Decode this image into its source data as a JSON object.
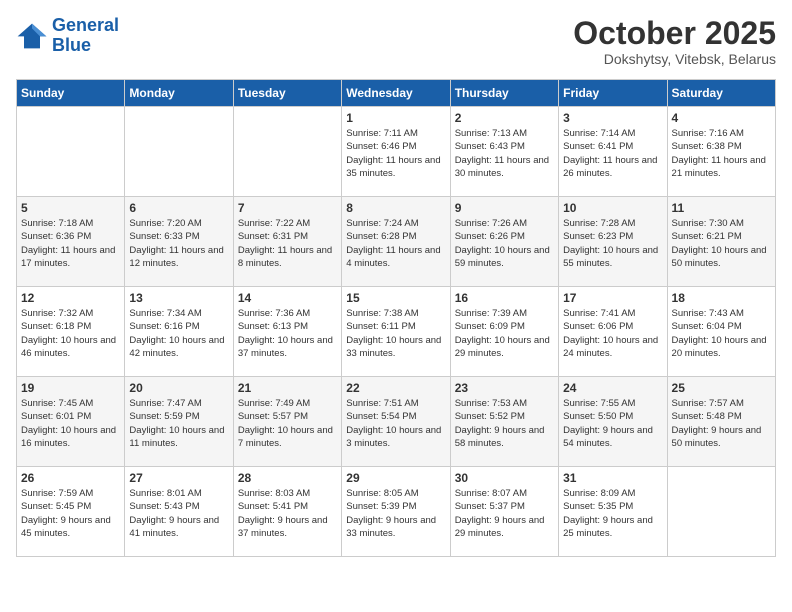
{
  "header": {
    "logo_line1": "General",
    "logo_line2": "Blue",
    "month": "October 2025",
    "location": "Dokshytsy, Vitebsk, Belarus"
  },
  "days_of_week": [
    "Sunday",
    "Monday",
    "Tuesday",
    "Wednesday",
    "Thursday",
    "Friday",
    "Saturday"
  ],
  "weeks": [
    [
      {
        "day": "",
        "info": ""
      },
      {
        "day": "",
        "info": ""
      },
      {
        "day": "",
        "info": ""
      },
      {
        "day": "1",
        "info": "Sunrise: 7:11 AM\nSunset: 6:46 PM\nDaylight: 11 hours and 35 minutes."
      },
      {
        "day": "2",
        "info": "Sunrise: 7:13 AM\nSunset: 6:43 PM\nDaylight: 11 hours and 30 minutes."
      },
      {
        "day": "3",
        "info": "Sunrise: 7:14 AM\nSunset: 6:41 PM\nDaylight: 11 hours and 26 minutes."
      },
      {
        "day": "4",
        "info": "Sunrise: 7:16 AM\nSunset: 6:38 PM\nDaylight: 11 hours and 21 minutes."
      }
    ],
    [
      {
        "day": "5",
        "info": "Sunrise: 7:18 AM\nSunset: 6:36 PM\nDaylight: 11 hours and 17 minutes."
      },
      {
        "day": "6",
        "info": "Sunrise: 7:20 AM\nSunset: 6:33 PM\nDaylight: 11 hours and 12 minutes."
      },
      {
        "day": "7",
        "info": "Sunrise: 7:22 AM\nSunset: 6:31 PM\nDaylight: 11 hours and 8 minutes."
      },
      {
        "day": "8",
        "info": "Sunrise: 7:24 AM\nSunset: 6:28 PM\nDaylight: 11 hours and 4 minutes."
      },
      {
        "day": "9",
        "info": "Sunrise: 7:26 AM\nSunset: 6:26 PM\nDaylight: 10 hours and 59 minutes."
      },
      {
        "day": "10",
        "info": "Sunrise: 7:28 AM\nSunset: 6:23 PM\nDaylight: 10 hours and 55 minutes."
      },
      {
        "day": "11",
        "info": "Sunrise: 7:30 AM\nSunset: 6:21 PM\nDaylight: 10 hours and 50 minutes."
      }
    ],
    [
      {
        "day": "12",
        "info": "Sunrise: 7:32 AM\nSunset: 6:18 PM\nDaylight: 10 hours and 46 minutes."
      },
      {
        "day": "13",
        "info": "Sunrise: 7:34 AM\nSunset: 6:16 PM\nDaylight: 10 hours and 42 minutes."
      },
      {
        "day": "14",
        "info": "Sunrise: 7:36 AM\nSunset: 6:13 PM\nDaylight: 10 hours and 37 minutes."
      },
      {
        "day": "15",
        "info": "Sunrise: 7:38 AM\nSunset: 6:11 PM\nDaylight: 10 hours and 33 minutes."
      },
      {
        "day": "16",
        "info": "Sunrise: 7:39 AM\nSunset: 6:09 PM\nDaylight: 10 hours and 29 minutes."
      },
      {
        "day": "17",
        "info": "Sunrise: 7:41 AM\nSunset: 6:06 PM\nDaylight: 10 hours and 24 minutes."
      },
      {
        "day": "18",
        "info": "Sunrise: 7:43 AM\nSunset: 6:04 PM\nDaylight: 10 hours and 20 minutes."
      }
    ],
    [
      {
        "day": "19",
        "info": "Sunrise: 7:45 AM\nSunset: 6:01 PM\nDaylight: 10 hours and 16 minutes."
      },
      {
        "day": "20",
        "info": "Sunrise: 7:47 AM\nSunset: 5:59 PM\nDaylight: 10 hours and 11 minutes."
      },
      {
        "day": "21",
        "info": "Sunrise: 7:49 AM\nSunset: 5:57 PM\nDaylight: 10 hours and 7 minutes."
      },
      {
        "day": "22",
        "info": "Sunrise: 7:51 AM\nSunset: 5:54 PM\nDaylight: 10 hours and 3 minutes."
      },
      {
        "day": "23",
        "info": "Sunrise: 7:53 AM\nSunset: 5:52 PM\nDaylight: 9 hours and 58 minutes."
      },
      {
        "day": "24",
        "info": "Sunrise: 7:55 AM\nSunset: 5:50 PM\nDaylight: 9 hours and 54 minutes."
      },
      {
        "day": "25",
        "info": "Sunrise: 7:57 AM\nSunset: 5:48 PM\nDaylight: 9 hours and 50 minutes."
      }
    ],
    [
      {
        "day": "26",
        "info": "Sunrise: 7:59 AM\nSunset: 5:45 PM\nDaylight: 9 hours and 45 minutes."
      },
      {
        "day": "27",
        "info": "Sunrise: 8:01 AM\nSunset: 5:43 PM\nDaylight: 9 hours and 41 minutes."
      },
      {
        "day": "28",
        "info": "Sunrise: 8:03 AM\nSunset: 5:41 PM\nDaylight: 9 hours and 37 minutes."
      },
      {
        "day": "29",
        "info": "Sunrise: 8:05 AM\nSunset: 5:39 PM\nDaylight: 9 hours and 33 minutes."
      },
      {
        "day": "30",
        "info": "Sunrise: 8:07 AM\nSunset: 5:37 PM\nDaylight: 9 hours and 29 minutes."
      },
      {
        "day": "31",
        "info": "Sunrise: 8:09 AM\nSunset: 5:35 PM\nDaylight: 9 hours and 25 minutes."
      },
      {
        "day": "",
        "info": ""
      }
    ]
  ]
}
